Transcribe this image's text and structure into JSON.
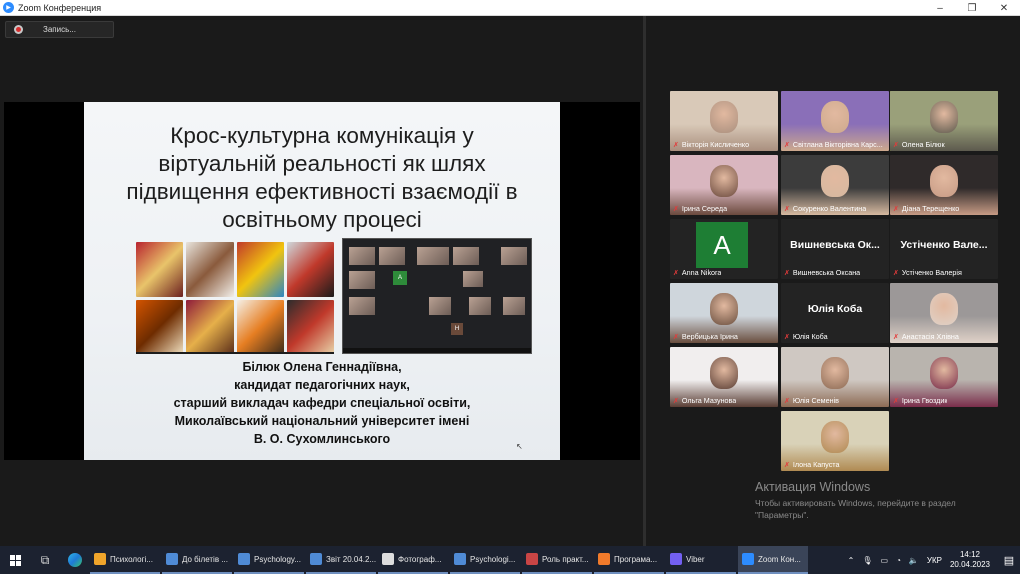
{
  "window": {
    "title": "Zoom Конференция",
    "minimize": "–",
    "maximize": "❐",
    "close": "✕"
  },
  "record": {
    "label": "Запись..."
  },
  "slide": {
    "title": "Крос-культурна комунікація у\nвіртуальній реальності як шлях\nпідвищення ефективності взаємодії в\nосвітньому процесі",
    "author": "Білюк Олена Геннадіївна,\nкандидат педагогічних наук,\nстарший викладач кафедри спеціальної освіти,\nМиколаївський національний університет імені\nВ. О. Сухомлинського",
    "zoom_shot_avatar": "A",
    "zoom_shot_avatar2": "H"
  },
  "participants": [
    {
      "name": "Вікторія Кисличенко",
      "kind": "video",
      "colors": [
        "#d9c9b8",
        "#a98f7e"
      ]
    },
    {
      "name": "Світлана Вікторівна Карс...",
      "kind": "video",
      "colors": [
        "#8a6fb8",
        "#cda98d"
      ]
    },
    {
      "name": "Олена Білюк",
      "kind": "video",
      "active": true,
      "colors": [
        "#9aa07a",
        "#5d5a4e"
      ]
    },
    {
      "name": "Ірина Середа",
      "kind": "video",
      "colors": [
        "#d9b6bf",
        "#6b4a3e"
      ]
    },
    {
      "name": "Сокуренко Валентина",
      "kind": "video",
      "colors": [
        "#3c3c3c",
        "#d6b9a0"
      ]
    },
    {
      "name": "Діана Терещенко",
      "kind": "video",
      "colors": [
        "#2f2a2a",
        "#c79b85"
      ]
    },
    {
      "name": "Anna Nikora",
      "kind": "avatar",
      "letter": "A"
    },
    {
      "name": "Вишневська Оксана",
      "kind": "text",
      "big": "Вишневська Ок..."
    },
    {
      "name": "Устіченко Валерія",
      "kind": "text",
      "big": "Устіченко Вале..."
    },
    {
      "name": "Вербицька Ірина",
      "kind": "video",
      "colors": [
        "#cfd6dc",
        "#6a4f3f"
      ]
    },
    {
      "name": "Юлія Коба",
      "kind": "text",
      "big": "Юлія Коба"
    },
    {
      "name": "Анастасія Хлівна",
      "kind": "video",
      "colors": [
        "#9c9898",
        "#e0d2c8"
      ]
    },
    {
      "name": "Ольга Мазунова",
      "kind": "video",
      "colors": [
        "#f1eeee",
        "#5a3e35"
      ]
    },
    {
      "name": "Юлія Семенів",
      "kind": "video",
      "colors": [
        "#cfc8c2",
        "#8d6b55"
      ]
    },
    {
      "name": "Ірина Гвоздик",
      "kind": "video",
      "colors": [
        "#b9b4ae",
        "#7a2e4b"
      ]
    },
    {
      "name": "Ілона Капуста",
      "kind": "video",
      "colors": [
        "#d9d2b8",
        "#b08a52"
      ]
    }
  ],
  "activation": {
    "line1": "Активация Windows",
    "line2": "Чтобы активировать Windows, перейдите в раздел",
    "line3": "\"Параметры\"."
  },
  "taskbar": {
    "apps": [
      {
        "label": "Психологі...",
        "color": "#f0a52b"
      },
      {
        "label": "До білетів ...",
        "color": "#4f8bd6"
      },
      {
        "label": "Psychology...",
        "color": "#4f8bd6"
      },
      {
        "label": "Звіт 20.04.2...",
        "color": "#4f8bd6"
      },
      {
        "label": "Фотограф...",
        "color": "#dddddd"
      },
      {
        "label": "Psychologi...",
        "color": "#4f8bd6"
      },
      {
        "label": "Роль практ...",
        "color": "#c94545"
      },
      {
        "label": "Програма...",
        "color": "#f07a2b"
      },
      {
        "label": "Viber",
        "color": "#7360f2"
      },
      {
        "label": "Zoom Кон...",
        "color": "#2d8cff",
        "active": true
      }
    ],
    "lang": "УКР",
    "time": "14:12",
    "date": "20.04.2023"
  },
  "colors": {
    "active_speaker": "#d7e94c",
    "mic_muted": "#e23b3b",
    "zoom_blue": "#2d8cff"
  }
}
